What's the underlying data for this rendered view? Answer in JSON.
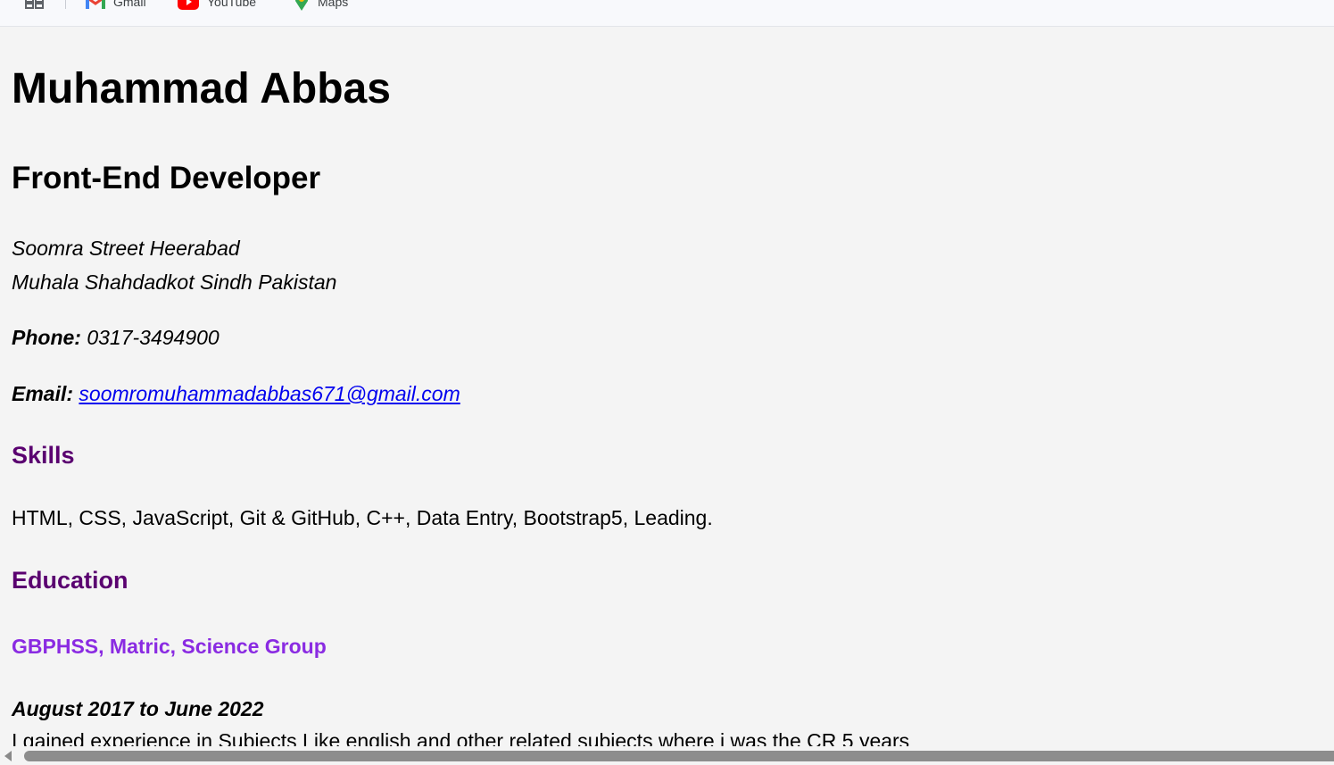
{
  "bookmarks": [
    {
      "label": "Gmail",
      "icon": "gmail-icon"
    },
    {
      "label": "YouTube",
      "icon": "youtube-icon"
    },
    {
      "label": "Maps",
      "icon": "maps-icon"
    }
  ],
  "resume": {
    "name": "Muhammad Abbas",
    "role": "Front-End Developer",
    "address_line1": "Soomra Street Heerabad",
    "address_line2": "Muhala Shahdadkot Sindh Pakistan",
    "phone_label": "Phone:",
    "phone_value": "0317-3494900",
    "email_label": "Email:",
    "email_value": "soomromuhammadabbas671@gmail.com",
    "skills_heading": "Skills",
    "skills_text": "HTML, CSS, JavaScript, Git & GitHub, C++, Data Entry, Bootstrap5, Leading.",
    "education_heading": "Education",
    "school": "GBPHSS, Matric, Science Group",
    "dates": "August 2017 to June 2022",
    "description": "I gained experience in Subjects Like english and other related subjects where i was the CR 5 years"
  },
  "colors": {
    "section_heading": "#5a0070",
    "school": "#8a2be2",
    "link": "#0000ee",
    "background": "#f4f4f4"
  }
}
